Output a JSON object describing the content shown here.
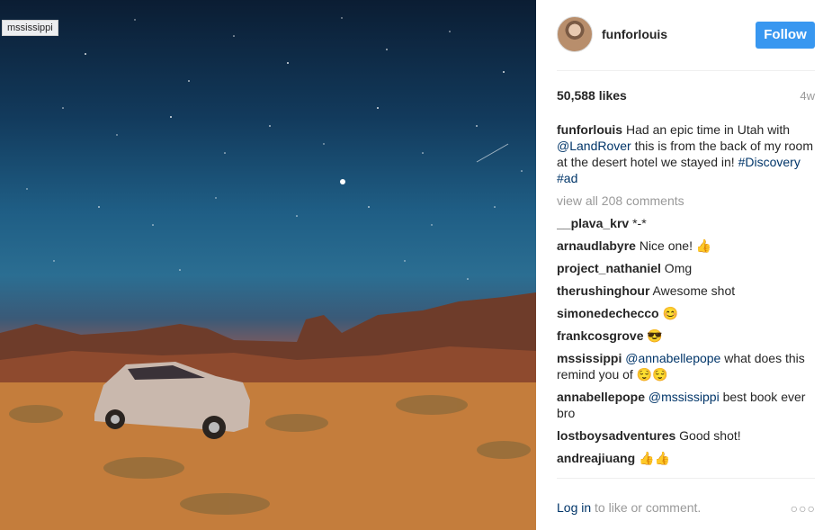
{
  "photo": {
    "tag": "mssissippi",
    "sky_color": "#1f5e85",
    "ground_color": "#c9803e"
  },
  "header": {
    "username": "funforlouis",
    "follow_label": "Follow",
    "accent": "#3897f0"
  },
  "stats": {
    "likes": "50,588 likes",
    "age": "4w"
  },
  "caption": {
    "user": "funforlouis",
    "text_1": " Had an epic time in Utah with ",
    "mention": "@LandRover",
    "text_2": " this is from the back of my room at the desert hotel we stayed in! ",
    "tag_1": "#Discovery",
    "tag_2": "#ad"
  },
  "view_all": "view all 208 comments",
  "comments": [
    {
      "user": "__plava_krv",
      "text": " *-*"
    },
    {
      "user": "arnaudlabyre",
      "text": " Nice one! 👍"
    },
    {
      "user": "project_nathaniel",
      "text": " Omg"
    },
    {
      "user": "therushinghour",
      "text": " Awesome shot"
    },
    {
      "user": "simonedechecco",
      "text": " 😊"
    },
    {
      "user": "frankcosgrove",
      "text": " 😎"
    },
    {
      "user": "mssissippi",
      "mention": " @annabellepope",
      "text": " what does this remind you of 😌😌"
    },
    {
      "user": "annabellepope",
      "mention": " @mssissippi",
      "text": " best book ever bro"
    },
    {
      "user": "lostboysadventures",
      "text": " Good shot!"
    },
    {
      "user": "andreajiuang",
      "text": " 👍👍"
    }
  ],
  "footer": {
    "login": "Log in",
    "rest": " to like or comment.",
    "more_icon": "ellipsis-icon"
  }
}
